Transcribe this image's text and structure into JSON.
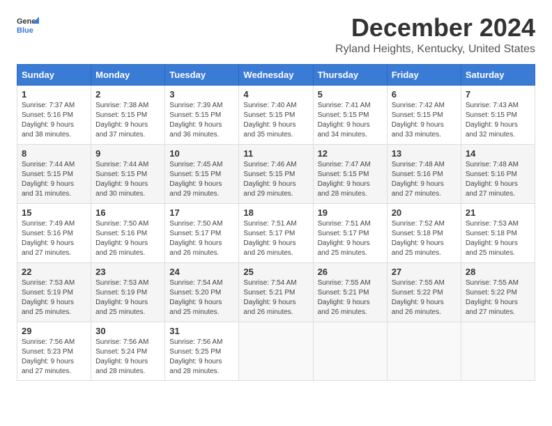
{
  "logo": {
    "general": "General",
    "blue": "Blue"
  },
  "title": "December 2024",
  "subtitle": "Ryland Heights, Kentucky, United States",
  "days_of_week": [
    "Sunday",
    "Monday",
    "Tuesday",
    "Wednesday",
    "Thursday",
    "Friday",
    "Saturday"
  ],
  "weeks": [
    [
      {
        "day": "1",
        "sunrise": "7:37 AM",
        "sunset": "5:16 PM",
        "daylight": "9 hours and 38 minutes."
      },
      {
        "day": "2",
        "sunrise": "7:38 AM",
        "sunset": "5:15 PM",
        "daylight": "9 hours and 37 minutes."
      },
      {
        "day": "3",
        "sunrise": "7:39 AM",
        "sunset": "5:15 PM",
        "daylight": "9 hours and 36 minutes."
      },
      {
        "day": "4",
        "sunrise": "7:40 AM",
        "sunset": "5:15 PM",
        "daylight": "9 hours and 35 minutes."
      },
      {
        "day": "5",
        "sunrise": "7:41 AM",
        "sunset": "5:15 PM",
        "daylight": "9 hours and 34 minutes."
      },
      {
        "day": "6",
        "sunrise": "7:42 AM",
        "sunset": "5:15 PM",
        "daylight": "9 hours and 33 minutes."
      },
      {
        "day": "7",
        "sunrise": "7:43 AM",
        "sunset": "5:15 PM",
        "daylight": "9 hours and 32 minutes."
      }
    ],
    [
      {
        "day": "8",
        "sunrise": "7:44 AM",
        "sunset": "5:15 PM",
        "daylight": "9 hours and 31 minutes."
      },
      {
        "day": "9",
        "sunrise": "7:44 AM",
        "sunset": "5:15 PM",
        "daylight": "9 hours and 30 minutes."
      },
      {
        "day": "10",
        "sunrise": "7:45 AM",
        "sunset": "5:15 PM",
        "daylight": "9 hours and 29 minutes."
      },
      {
        "day": "11",
        "sunrise": "7:46 AM",
        "sunset": "5:15 PM",
        "daylight": "9 hours and 29 minutes."
      },
      {
        "day": "12",
        "sunrise": "7:47 AM",
        "sunset": "5:15 PM",
        "daylight": "9 hours and 28 minutes."
      },
      {
        "day": "13",
        "sunrise": "7:48 AM",
        "sunset": "5:16 PM",
        "daylight": "9 hours and 27 minutes."
      },
      {
        "day": "14",
        "sunrise": "7:48 AM",
        "sunset": "5:16 PM",
        "daylight": "9 hours and 27 minutes."
      }
    ],
    [
      {
        "day": "15",
        "sunrise": "7:49 AM",
        "sunset": "5:16 PM",
        "daylight": "9 hours and 27 minutes."
      },
      {
        "day": "16",
        "sunrise": "7:50 AM",
        "sunset": "5:16 PM",
        "daylight": "9 hours and 26 minutes."
      },
      {
        "day": "17",
        "sunrise": "7:50 AM",
        "sunset": "5:17 PM",
        "daylight": "9 hours and 26 minutes."
      },
      {
        "day": "18",
        "sunrise": "7:51 AM",
        "sunset": "5:17 PM",
        "daylight": "9 hours and 26 minutes."
      },
      {
        "day": "19",
        "sunrise": "7:51 AM",
        "sunset": "5:17 PM",
        "daylight": "9 hours and 25 minutes."
      },
      {
        "day": "20",
        "sunrise": "7:52 AM",
        "sunset": "5:18 PM",
        "daylight": "9 hours and 25 minutes."
      },
      {
        "day": "21",
        "sunrise": "7:53 AM",
        "sunset": "5:18 PM",
        "daylight": "9 hours and 25 minutes."
      }
    ],
    [
      {
        "day": "22",
        "sunrise": "7:53 AM",
        "sunset": "5:19 PM",
        "daylight": "9 hours and 25 minutes."
      },
      {
        "day": "23",
        "sunrise": "7:53 AM",
        "sunset": "5:19 PM",
        "daylight": "9 hours and 25 minutes."
      },
      {
        "day": "24",
        "sunrise": "7:54 AM",
        "sunset": "5:20 PM",
        "daylight": "9 hours and 25 minutes."
      },
      {
        "day": "25",
        "sunrise": "7:54 AM",
        "sunset": "5:21 PM",
        "daylight": "9 hours and 26 minutes."
      },
      {
        "day": "26",
        "sunrise": "7:55 AM",
        "sunset": "5:21 PM",
        "daylight": "9 hours and 26 minutes."
      },
      {
        "day": "27",
        "sunrise": "7:55 AM",
        "sunset": "5:22 PM",
        "daylight": "9 hours and 26 minutes."
      },
      {
        "day": "28",
        "sunrise": "7:55 AM",
        "sunset": "5:22 PM",
        "daylight": "9 hours and 27 minutes."
      }
    ],
    [
      {
        "day": "29",
        "sunrise": "7:56 AM",
        "sunset": "5:23 PM",
        "daylight": "9 hours and 27 minutes."
      },
      {
        "day": "30",
        "sunrise": "7:56 AM",
        "sunset": "5:24 PM",
        "daylight": "9 hours and 28 minutes."
      },
      {
        "day": "31",
        "sunrise": "7:56 AM",
        "sunset": "5:25 PM",
        "daylight": "9 hours and 28 minutes."
      },
      null,
      null,
      null,
      null
    ]
  ]
}
